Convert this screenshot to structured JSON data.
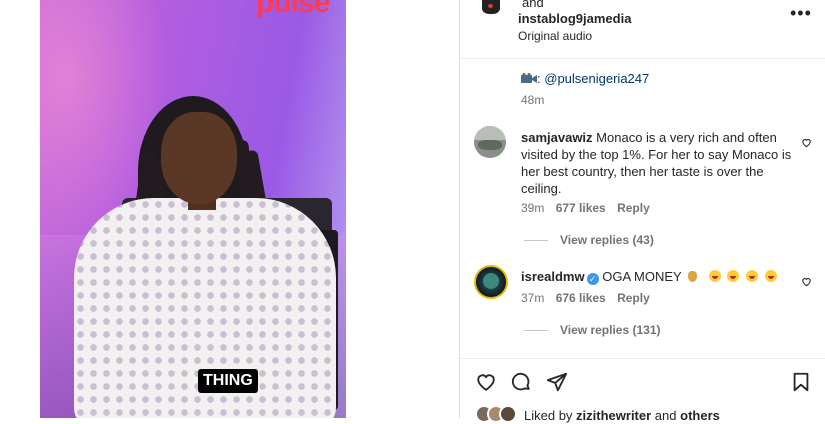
{
  "post": {
    "header_and": "and",
    "collaborator": "instablog9jamedia",
    "audio": "Original audio",
    "more_icon": "more-horizontal-icon"
  },
  "video": {
    "logo_text": "pulse",
    "caption": "THING"
  },
  "description": {
    "icon": "film-camera-icon",
    "separator": ":",
    "mention": "@pulsenigeria247",
    "time": "48m"
  },
  "comments": [
    {
      "username": "samjavawiz",
      "text_lines": [
        "Monaco is a very rich and often",
        "visited by the top 1%. For her to say Monaco is",
        "her best country, then her taste is over the",
        "ceiling."
      ],
      "time": "39m",
      "likes": "677 likes",
      "reply": "Reply",
      "view_replies": "View replies (43)"
    },
    {
      "username": "isrealdmw",
      "verified": true,
      "text": "OGA MONEY",
      "emojis": [
        "money-bag",
        "laughing",
        "laughing",
        "laughing",
        "laughing"
      ],
      "time": "37m",
      "likes": "676 likes",
      "reply": "Reply",
      "view_replies": "View replies (131)"
    }
  ],
  "actions": {
    "like_icon": "heart-icon",
    "comment_icon": "comment-icon",
    "share_icon": "send-icon",
    "save_icon": "bookmark-icon"
  },
  "likes_summary": {
    "prefix": "Liked by",
    "user": "zizithewriter",
    "conj": "and",
    "others": "others"
  },
  "colors": {
    "accent_link": "#00376b",
    "verified_blue": "#3897f0",
    "muted": "#737373"
  }
}
